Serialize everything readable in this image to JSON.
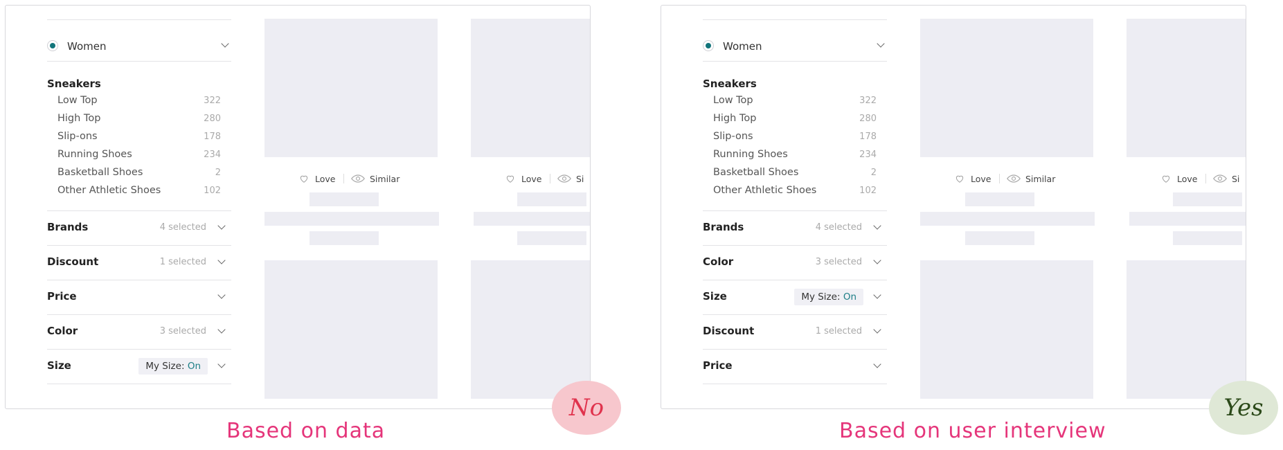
{
  "colors": {
    "accent": "#12747a",
    "on_text": "#1c7e86",
    "caption": "#e5357a",
    "no_bubble": "#f7c7cd",
    "no_text": "#e0334d",
    "yes_bubble": "#dfe8d6",
    "yes_text": "#2c4a1a"
  },
  "left": {
    "gender": "Women",
    "category_title": "Sneakers",
    "subcategories": [
      {
        "name": "Low Top",
        "count": "322"
      },
      {
        "name": "High Top",
        "count": "280"
      },
      {
        "name": "Slip-ons",
        "count": "178"
      },
      {
        "name": "Running Shoes",
        "count": "234"
      },
      {
        "name": "Basketball Shoes",
        "count": "2"
      },
      {
        "name": "Other Athletic Shoes",
        "count": "102"
      }
    ],
    "facets": [
      {
        "title": "Brands",
        "selected": "4 selected"
      },
      {
        "title": "Discount",
        "selected": "1 selected"
      },
      {
        "title": "Price",
        "selected": ""
      },
      {
        "title": "Color",
        "selected": "3 selected"
      },
      {
        "title": "Size",
        "mysize_label": "My Size:",
        "mysize_value": "On"
      }
    ],
    "actions": {
      "love": "Love",
      "similar": "Similar",
      "similar_cut": "Si"
    },
    "caption": "Based on data",
    "bubble": "No"
  },
  "right": {
    "gender": "Women",
    "category_title": "Sneakers",
    "subcategories": [
      {
        "name": "Low Top",
        "count": "322"
      },
      {
        "name": "High Top",
        "count": "280"
      },
      {
        "name": "Slip-ons",
        "count": "178"
      },
      {
        "name": "Running Shoes",
        "count": "234"
      },
      {
        "name": "Basketball Shoes",
        "count": "2"
      },
      {
        "name": "Other Athletic Shoes",
        "count": "102"
      }
    ],
    "facets": [
      {
        "title": "Brands",
        "selected": "4 selected"
      },
      {
        "title": "Color",
        "selected": "3 selected"
      },
      {
        "title": "Size",
        "mysize_label": "My Size:",
        "mysize_value": "On"
      },
      {
        "title": "Discount",
        "selected": "1 selected"
      },
      {
        "title": "Price",
        "selected": ""
      }
    ],
    "actions": {
      "love": "Love",
      "similar": "Similar",
      "similar_cut": "Si"
    },
    "caption": "Based on user interview",
    "bubble": "Yes"
  }
}
